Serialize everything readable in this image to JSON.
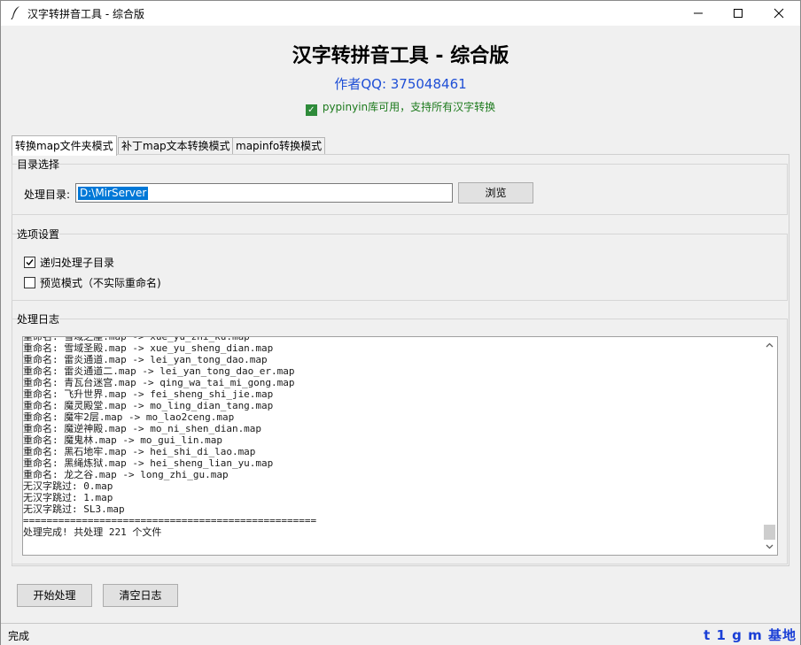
{
  "window": {
    "title": "汉字转拼音工具 - 综合版",
    "icon": "feather-icon"
  },
  "header": {
    "title": "汉字转拼音工具 - 综合版",
    "author": "作者QQ: 375048461",
    "status": "pypinyin库可用，支持所有汉字转换"
  },
  "tabs": [
    {
      "label": "转换map文件夹模式",
      "active": true
    },
    {
      "label": "补丁map文本转换模式",
      "active": false
    },
    {
      "label": "mapinfo转换模式",
      "active": false
    }
  ],
  "directory": {
    "group_label": "目录选择",
    "field_label": "处理目录:",
    "value": "D:\\MirServer",
    "browse_label": "浏览"
  },
  "options": {
    "group_label": "选项设置",
    "recursive_label": "递归处理子目录",
    "recursive_checked": true,
    "preview_label": "预览模式（不实际重命名)",
    "preview_checked": false
  },
  "log": {
    "group_label": "处理日志",
    "lines": [
      "重命名: 雪域之崖.map -> xue_yu_zhi_ku.map",
      "重命名: 雪域圣殿.map -> xue_yu_sheng_dian.map",
      "重命名: 雷炎通道.map -> lei_yan_tong_dao.map",
      "重命名: 雷炎通道二.map -> lei_yan_tong_dao_er.map",
      "重命名: 青瓦台迷宫.map -> qing_wa_tai_mi_gong.map",
      "重命名: 飞升世界.map -> fei_sheng_shi_jie.map",
      "重命名: 魔灵殿堂.map -> mo_ling_dian_tang.map",
      "重命名: 魔牢2层.map -> mo_lao2ceng.map",
      "重命名: 魔逆神殿.map -> mo_ni_shen_dian.map",
      "重命名: 魔鬼林.map -> mo_gui_lin.map",
      "重命名: 黑石地牢.map -> hei_shi_di_lao.map",
      "重命名: 黑绳炼狱.map -> hei_sheng_lian_yu.map",
      "重命名: 龙之谷.map -> long_zhi_gu.map",
      "无汉字跳过: 0.map",
      "无汉字跳过: 1.map",
      "无汉字跳过: SL3.map",
      "==================================================",
      "处理完成! 共处理 221 个文件"
    ]
  },
  "actions": {
    "start_label": "开始处理",
    "clear_label": "清空日志"
  },
  "statusbar": {
    "left": "完成",
    "right": "t 1 g m 基地"
  }
}
